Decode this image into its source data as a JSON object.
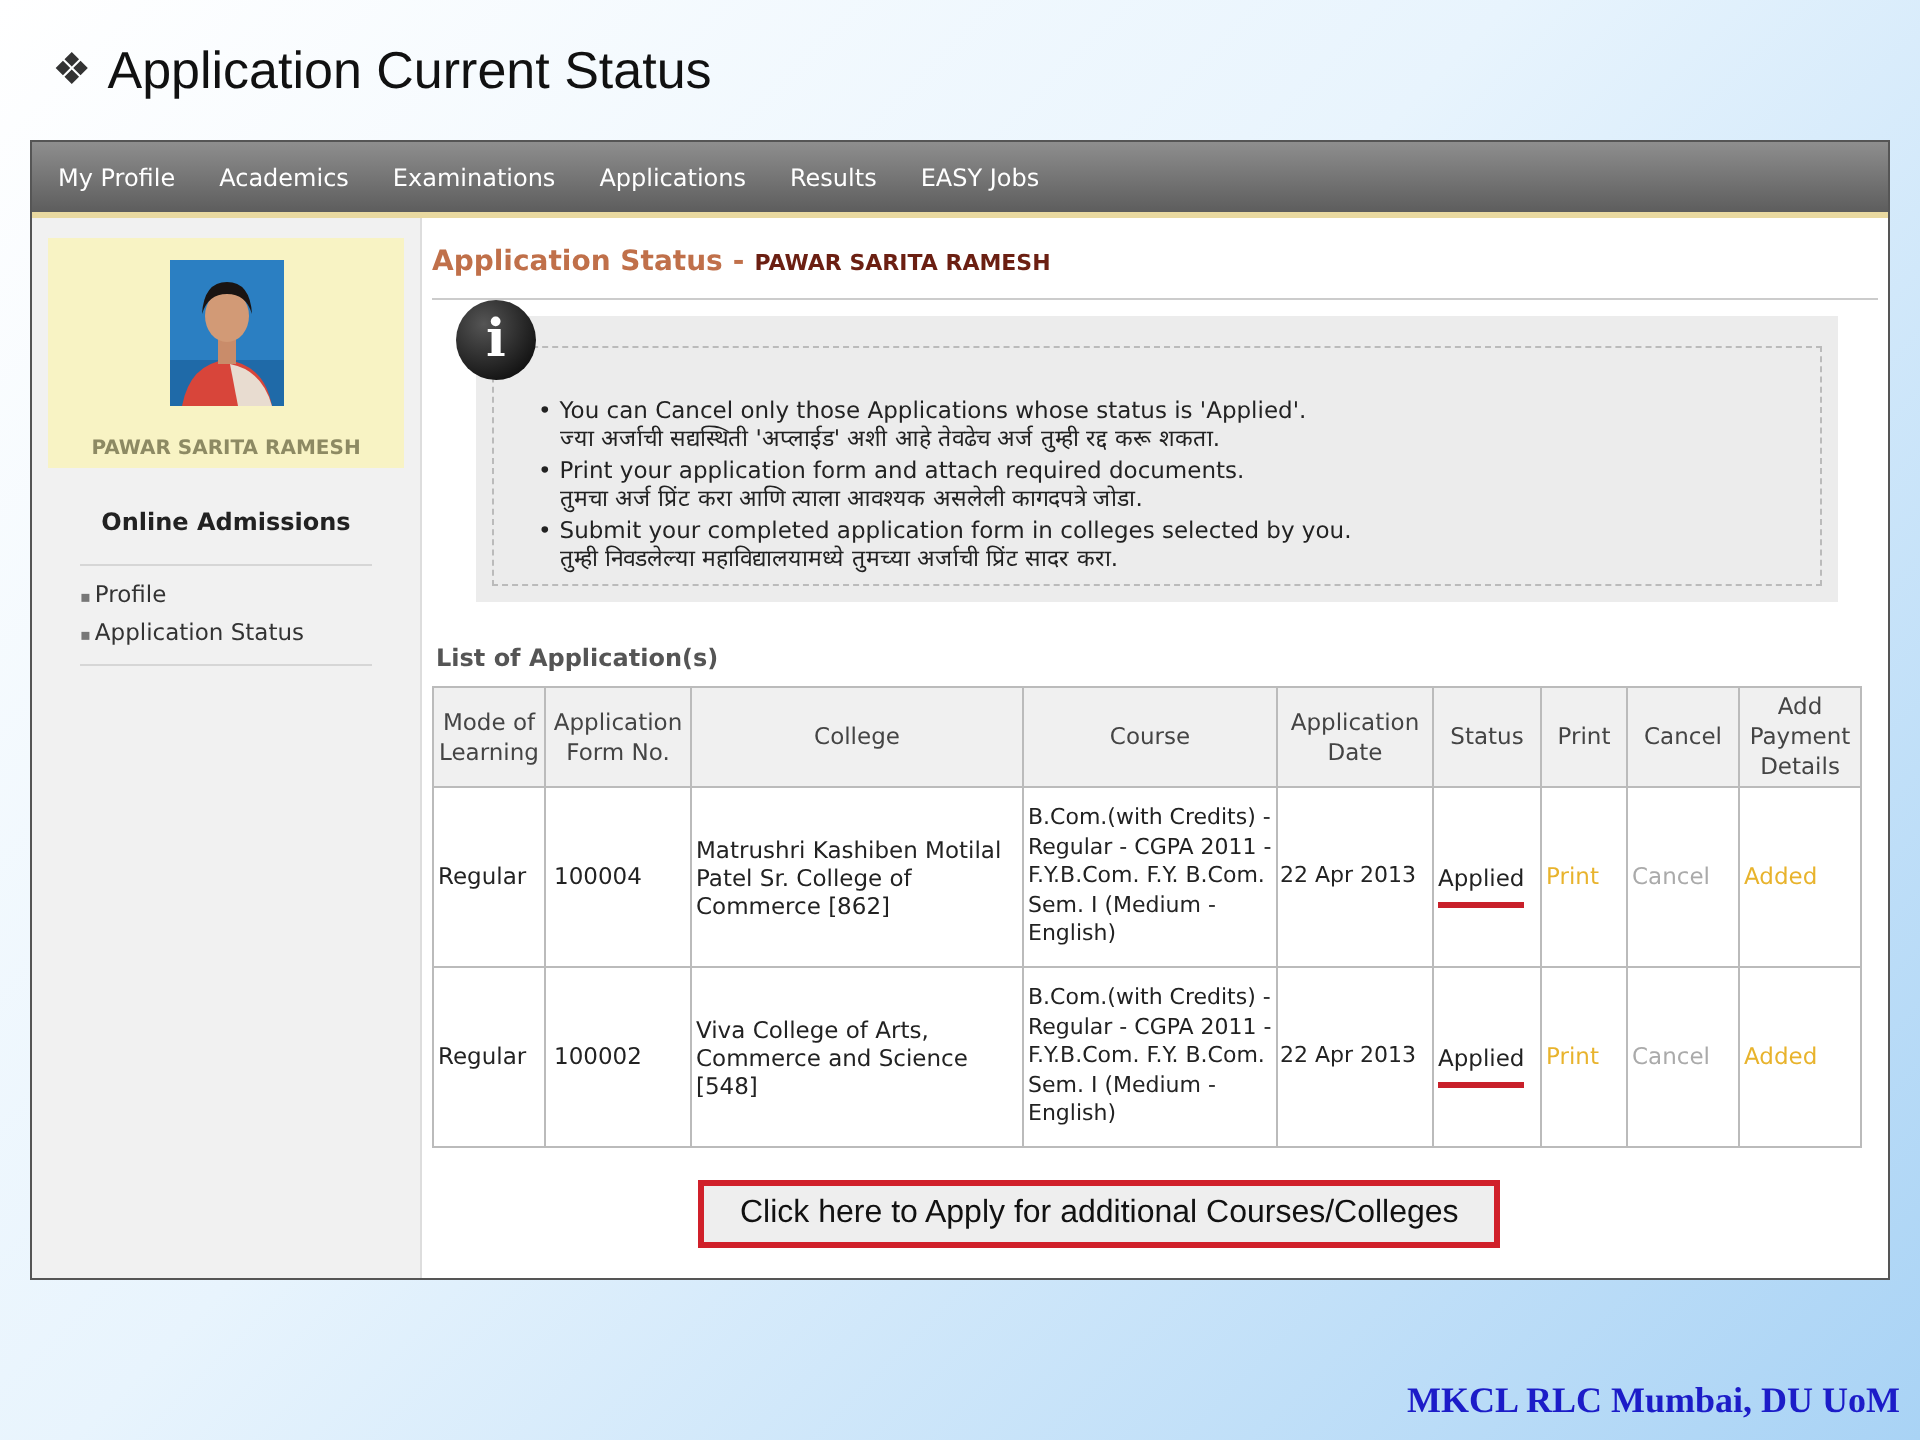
{
  "slide": {
    "bullet": "❖",
    "title": "Application Current Status",
    "footer": "MKCL RLC Mumbai, DU UoM"
  },
  "nav": {
    "items": [
      {
        "label": "My Profile"
      },
      {
        "label": "Academics"
      },
      {
        "label": "Examinations"
      },
      {
        "label": "Applications"
      },
      {
        "label": "Results"
      },
      {
        "label": "EASY Jobs"
      }
    ]
  },
  "sidebar": {
    "name": "PAWAR SARITA RAMESH",
    "heading": "Online Admissions",
    "links": [
      {
        "bullet": "▪",
        "label": "Profile"
      },
      {
        "bullet": "▪",
        "label": "Application Status"
      }
    ]
  },
  "page": {
    "title": "Application Status",
    "separator": "-",
    "student": "PAWAR SARITA RAMESH",
    "info": {
      "icon": "i",
      "notes": [
        {
          "bullet": "•",
          "english": "You can Cancel only those Applications whose status is 'Applied'.",
          "marathi": "ज्या अर्जाची सद्यस्थिती 'अप्लाईड' अशी आहे तेवढेच अर्ज तुम्ही रद्द करू शकता."
        },
        {
          "bullet": "•",
          "english": "Print your application form and attach required documents.",
          "marathi": "तुमचा अर्ज प्रिंट करा आणि त्याला आवश्यक असलेली कागदपत्रे जोडा."
        },
        {
          "bullet": "•",
          "english": "Submit your completed application form in colleges selected by you.",
          "marathi": "तुम्ही निवडलेल्या महाविद्यालयामध्ये तुमच्या अर्जाची प्रिंट सादर करा."
        }
      ]
    },
    "list_title": "List of Application(s)",
    "table": {
      "columns": [
        "Mode of Learning",
        "Application Form No.",
        "College",
        "Course",
        "Application Date",
        "Status",
        "Print",
        "Cancel",
        "Add Payment Details"
      ],
      "rows": [
        {
          "mode": "Regular",
          "form_no": "100004",
          "college": "Matrushri Kashiben Motilal Patel Sr. College of Commerce [862]",
          "course": "B.Com.(with Credits) - Regular - CGPA 2011 - F.Y.B.Com. F.Y. B.Com. Sem. I (Medium - English)",
          "date": "22 Apr 2013",
          "status": "Applied",
          "highlighted": true,
          "print": "Print",
          "cancel": {
            "label": "Cancel",
            "disabled": true
          },
          "payment": "Added"
        },
        {
          "mode": "Regular",
          "form_no": "100002",
          "college": "Viva College of Arts, Commerce and Science [548]",
          "course": "B.Com.(with Credits) - Regular - CGPA 2011 - F.Y.B.Com. F.Y. B.Com. Sem. I (Medium - English)",
          "date": "22 Apr 2013",
          "status": "Applied",
          "highlighted": true,
          "print": "Print",
          "cancel": {
            "label": "Cancel",
            "disabled": true
          },
          "payment": "Added"
        }
      ]
    },
    "apply_button": {
      "label": "Click here to Apply for additional Courses/Colleges",
      "highlighted": true
    }
  }
}
